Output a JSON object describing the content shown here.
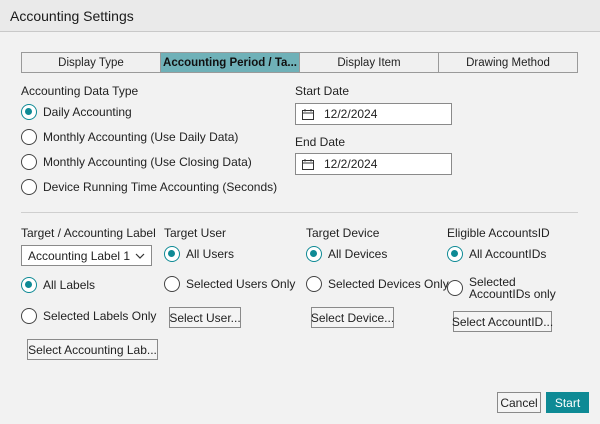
{
  "dialog": {
    "title": "Accounting Settings"
  },
  "tabs": [
    {
      "label": "Display Type",
      "active": false
    },
    {
      "label": "Accounting Period / Ta...",
      "active": true
    },
    {
      "label": "Display Item",
      "active": false
    },
    {
      "label": "Drawing Method",
      "active": false
    }
  ],
  "data_type": {
    "heading": "Accounting Data Type",
    "options": [
      {
        "label": "Daily Accounting",
        "checked": true
      },
      {
        "label": "Monthly Accounting (Use Daily Data)",
        "checked": false
      },
      {
        "label": "Monthly Accounting (Use Closing Data)",
        "checked": false
      },
      {
        "label": "Device Running Time Accounting (Seconds)",
        "checked": false
      }
    ]
  },
  "start_date": {
    "label": "Start Date",
    "value": "12/2/2024",
    "icon": "calendar-icon"
  },
  "end_date": {
    "label": "End Date",
    "value": "12/2/2024",
    "icon": "calendar-icon"
  },
  "target_label": {
    "heading": "Target / Accounting Label",
    "select_value": "Accounting Label 1",
    "options": [
      {
        "label": "All Labels",
        "checked": true
      },
      {
        "label": "Selected Labels Only",
        "checked": false
      }
    ],
    "button": "Select Accounting Lab..."
  },
  "target_user": {
    "heading": "Target User",
    "options": [
      {
        "label": "All Users",
        "checked": true
      },
      {
        "label": "Selected Users Only",
        "checked": false
      }
    ],
    "button": "Select User..."
  },
  "target_device": {
    "heading": "Target Device",
    "options": [
      {
        "label": "All Devices",
        "checked": true
      },
      {
        "label": "Selected Devices Only",
        "checked": false
      }
    ],
    "button": "Select Device..."
  },
  "eligible_accounts": {
    "heading": "Eligible AccountsID",
    "options": [
      {
        "label": "All AccountIDs",
        "checked": true
      },
      {
        "label": "Selected AccountIDs only",
        "checked": false
      }
    ],
    "button": "Select AccountID..."
  },
  "footer": {
    "cancel": "Cancel",
    "start": "Start"
  },
  "colors": {
    "accent": "#0e8a95",
    "active_tab": "#6fb1b8"
  }
}
